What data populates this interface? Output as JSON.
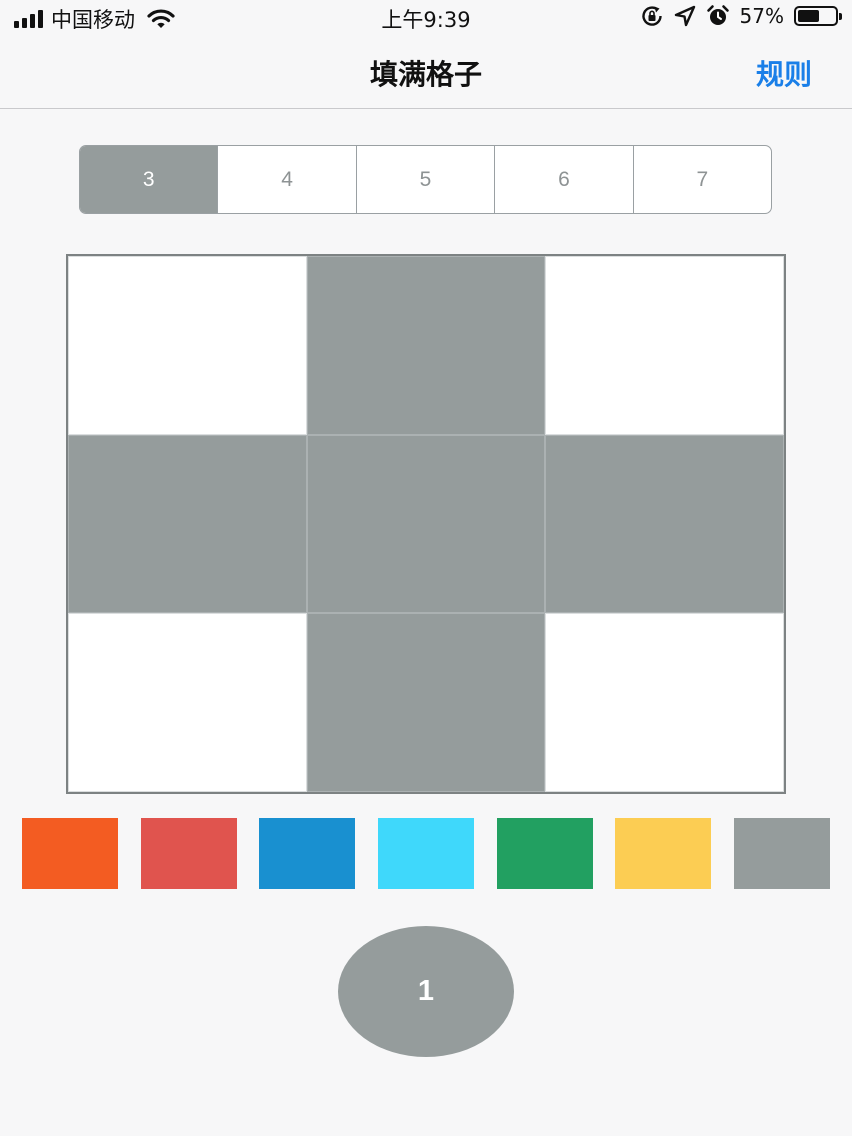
{
  "status_bar": {
    "carrier": "中国移动",
    "time": "上午9:39",
    "battery_percent": "57%",
    "battery_level": 0.57,
    "icons": [
      "signal-icon",
      "wifi-icon",
      "rotation-lock-icon",
      "location-icon",
      "alarm-icon",
      "battery-icon"
    ]
  },
  "nav": {
    "title": "填满格子",
    "rules_label": "规则"
  },
  "size_selector": {
    "options": [
      "3",
      "4",
      "5",
      "6",
      "7"
    ],
    "selected_index": 0
  },
  "board": {
    "size": 3,
    "fill_color": "#959c9c",
    "empty_color": "#ffffff",
    "cells": [
      [
        0,
        1,
        0
      ],
      [
        1,
        1,
        1
      ],
      [
        0,
        1,
        0
      ]
    ]
  },
  "palette": {
    "colors": [
      "#f35c22",
      "#e0544e",
      "#1990d0",
      "#3fd8fb",
      "#22a061",
      "#fccd53",
      "#959c9c"
    ]
  },
  "step_counter": {
    "value": "1",
    "color": "#959c9c"
  }
}
